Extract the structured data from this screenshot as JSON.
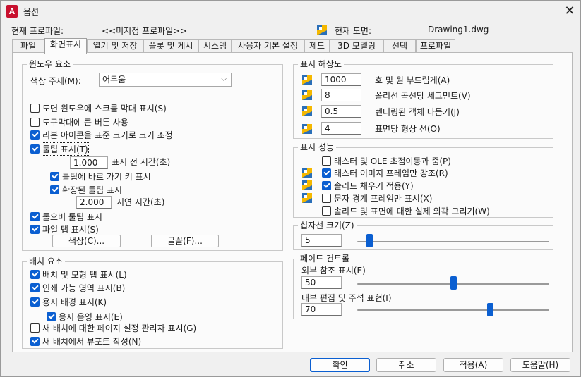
{
  "window": {
    "title": "옵션",
    "app_icon": "A"
  },
  "header": {
    "profile_label": "현재 프로파일:",
    "profile_value": "<<미지정 프로파일>>",
    "drawing_label": "현재 도면:",
    "drawing_value": "Drawing1.dwg"
  },
  "tabs": [
    "파일",
    "화면표시",
    "열기 및 저장",
    "플롯 및 게시",
    "시스템",
    "사용자 기본 설정",
    "제도",
    "3D 모델링",
    "선택",
    "프로파일"
  ],
  "active_tab": "화면표시",
  "window_elements": {
    "title": "윈도우 요소",
    "color_theme_label": "색상 주제(M):",
    "color_theme_value": "어두움",
    "checkboxes": [
      {
        "label": "도면 윈도우에 스크롤 막대 표시(S)",
        "checked": false
      },
      {
        "label": "도구막대에 큰 버튼 사용",
        "checked": false
      },
      {
        "label": "리본 아이콘을 표준 크기로 크기 조정",
        "checked": true
      },
      {
        "label": "툴팁 표시(T)",
        "checked": true
      },
      {
        "label": "툴팁에 바로 가기 키 표시",
        "checked": true
      },
      {
        "label": "확장된 툴팁 표시",
        "checked": true
      },
      {
        "label": "롤오버 툴팁 표시",
        "checked": true
      },
      {
        "label": "파일 탭 표시(S)",
        "checked": true
      }
    ],
    "tooltip_delay_value": "1.000",
    "tooltip_delay_label": "표시 전 시간(초)",
    "extended_delay_value": "2.000",
    "extended_delay_label": "지연 시간(초)",
    "colors_button": "색상(C)...",
    "fonts_button": "글꼴(F)..."
  },
  "layout_elements": {
    "title": "배치 요소",
    "checkboxes": [
      {
        "label": "배치 및 모형 탭 표시(L)",
        "checked": true
      },
      {
        "label": "인쇄 가능 영역 표시(B)",
        "checked": true
      },
      {
        "label": "용지 배경 표시(K)",
        "checked": true
      },
      {
        "label": "용지 음영 표시(E)",
        "checked": true
      },
      {
        "label": "새 배치에 대한 페이지 설정 관리자 표시(G)",
        "checked": false
      },
      {
        "label": "새 배치에서 뷰포트 작성(N)",
        "checked": true
      }
    ]
  },
  "display_resolution": {
    "title": "표시 해상도",
    "rows": [
      {
        "value": "1000",
        "label": "호 및 원 부드럽게(A)"
      },
      {
        "value": "8",
        "label": "폴리선 곡선당 세그먼트(V)"
      },
      {
        "value": "0.5",
        "label": "렌더링된 객체 다듬기(J)"
      },
      {
        "value": "4",
        "label": "표면당 형상 선(O)"
      }
    ]
  },
  "display_performance": {
    "title": "표시 성능",
    "checkboxes": [
      {
        "label": "래스터 및 OLE 초점이동과 줌(P)",
        "checked": false
      },
      {
        "label": "래스터 이미지 프레임만 강조(R)",
        "checked": true
      },
      {
        "label": "솔리드 채우기 적용(Y)",
        "checked": true
      },
      {
        "label": "문자 경계 프레임만 표시(X)",
        "checked": false
      },
      {
        "label": "솔리드 및 표면에 대한 실제 외곽 그리기(W)",
        "checked": false
      }
    ]
  },
  "crosshair": {
    "title": "십자선 크기(Z)",
    "value": "5",
    "level_percent": 5
  },
  "fade_control": {
    "title": "페이드 컨트롤",
    "xref_label": "외부 참조 표시(E)",
    "xref_value": "50",
    "xref_level": 50,
    "inplace_label": "내부 편집 및 주석 표현(I)",
    "inplace_value": "70",
    "inplace_level": 70
  },
  "buttons": {
    "ok": "확인",
    "cancel": "취소",
    "apply": "적용(A)",
    "help": "도움말(H)"
  },
  "colors": {
    "accent": "#0b5fd1",
    "app_icon": "#c8102e"
  }
}
